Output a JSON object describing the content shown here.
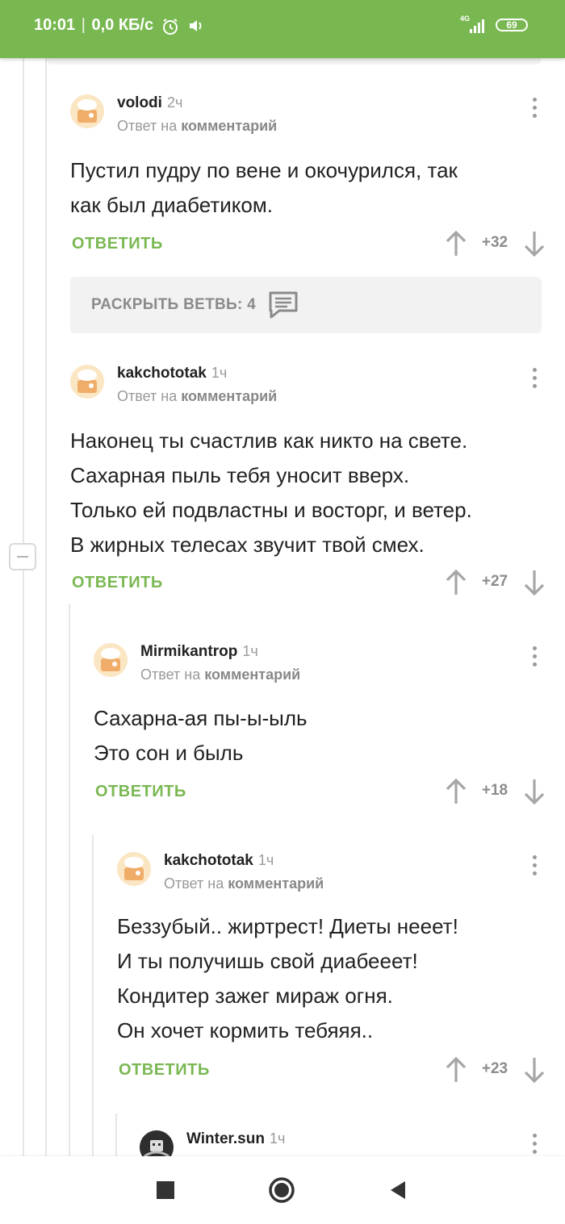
{
  "status_bar": {
    "time": "10:01",
    "speed": "0,0 КБ/с",
    "network": "4G",
    "battery": "69",
    "accent": "#79b851"
  },
  "comments": [
    {
      "author": "volodi",
      "time": "2ч",
      "reply_prefix": "Ответ на",
      "reply_target": "комментарий",
      "lines": [
        "Пустил пудру по вене и окочурился, так",
        "как был диабетиком."
      ],
      "reply_label": "ОТВЕТИТЬ",
      "score": "+32"
    },
    {
      "author": "kakchototak",
      "time": "1ч",
      "reply_prefix": "Ответ на",
      "reply_target": "комментарий",
      "lines": [
        "Наконец ты счастлив как никто на свете.",
        "Сахарная пыль тебя уносит вверх.",
        "Только ей подвластны и восторг, и ветер.",
        "В жирных телесах звучит твой смех."
      ],
      "reply_label": "ОТВЕТИТЬ",
      "score": "+27"
    },
    {
      "author": "Mirmikantrop",
      "time": "1ч",
      "reply_prefix": "Ответ на",
      "reply_target": "комментарий",
      "lines": [
        "Сахарна-ая пы-ы-ыль",
        "Это сон и быль"
      ],
      "reply_label": "ОТВЕТИТЬ",
      "score": "+18"
    },
    {
      "author": "kakchototak",
      "time": "1ч",
      "reply_prefix": "Ответ на",
      "reply_target": "комментарий",
      "lines": [
        "Беззубый.. жиртрест! Диеты нееет!",
        "И ты получишь свой диабееет!",
        "Кондитер зажег мираж огня.",
        "Он хочет кормить тебяяя.."
      ],
      "reply_label": "ОТВЕТИТЬ",
      "score": "+23"
    },
    {
      "author": "Winter.sun",
      "time": "1ч"
    }
  ],
  "expand_branch": {
    "label": "РАСКРЫТЬ ВЕТВЬ: 4",
    "icon": "comments-icon"
  },
  "colors": {
    "accent_green": "#7ab853",
    "muted": "#999999"
  }
}
